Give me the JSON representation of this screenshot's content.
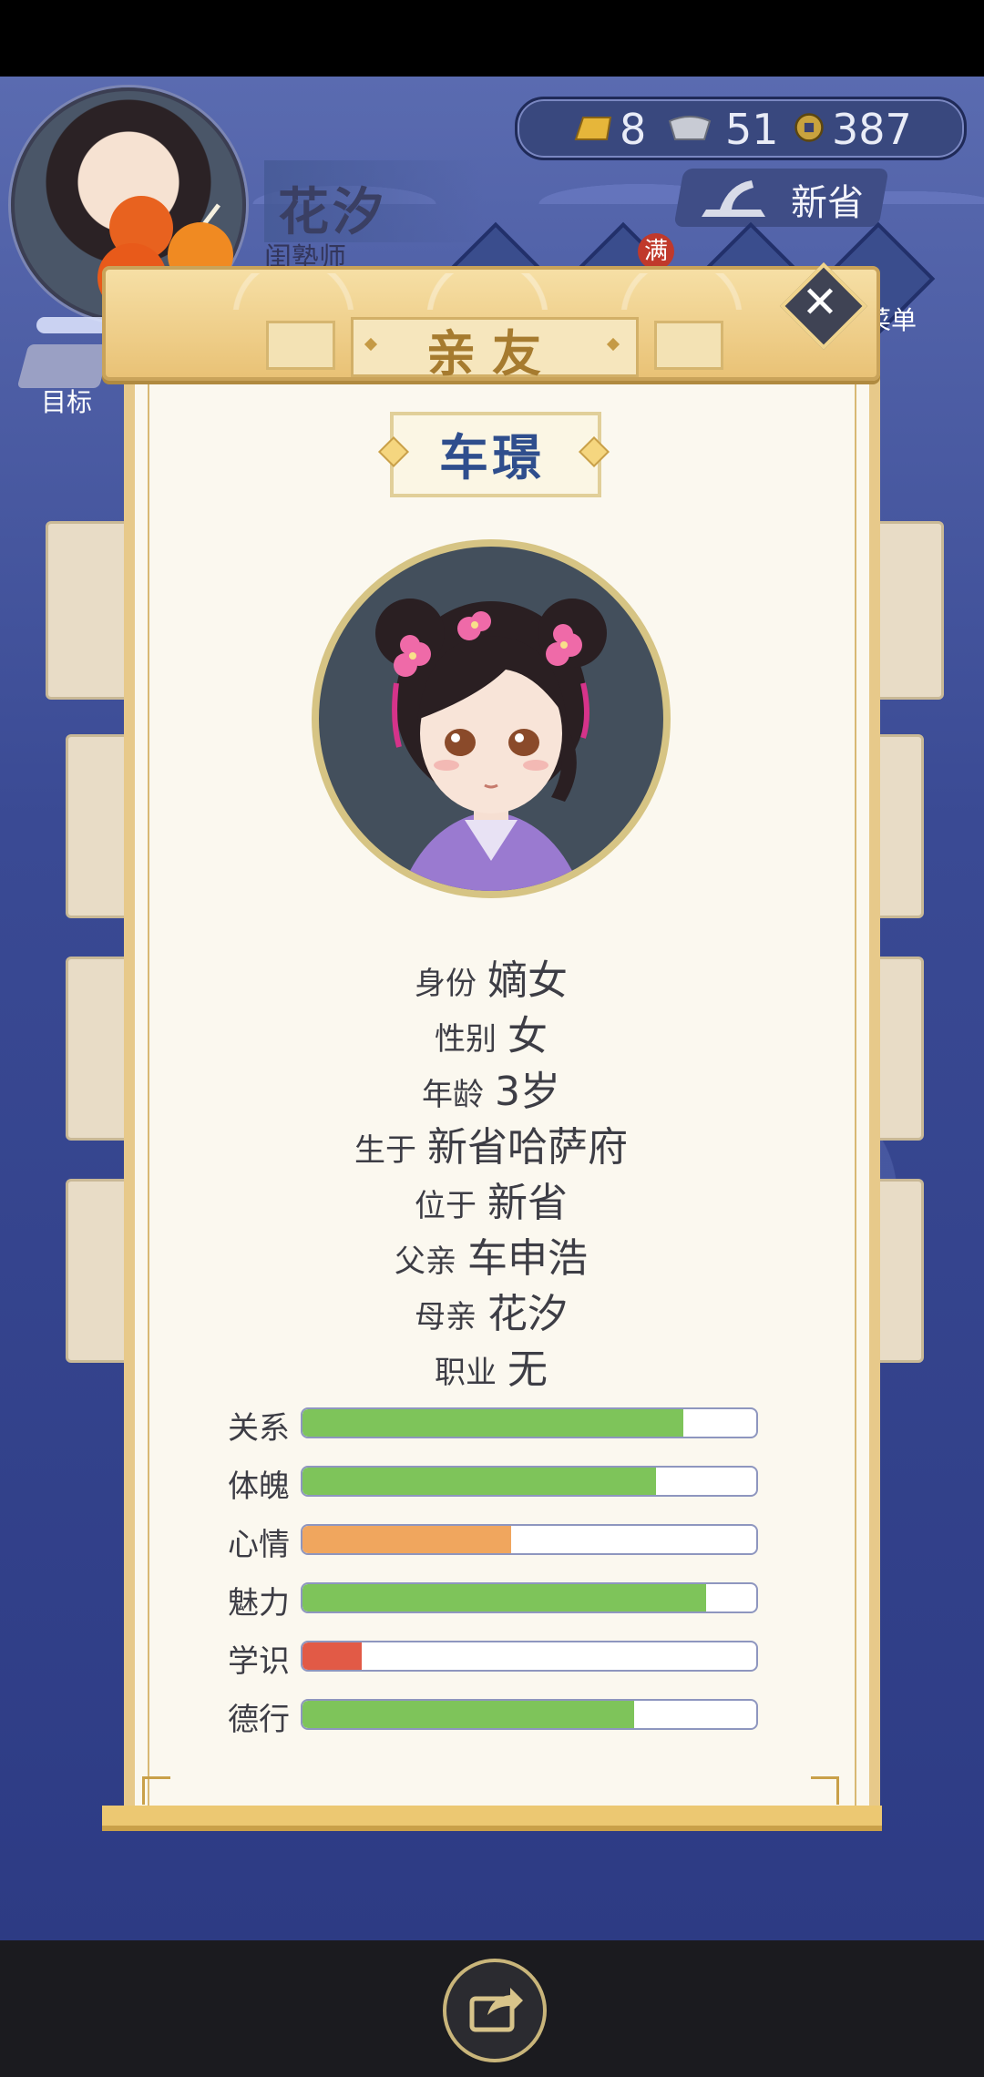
{
  "player": {
    "name": "花汐",
    "title": "闺塾师",
    "goal_label": "目标"
  },
  "currency": {
    "gold": "8",
    "silver": "51",
    "coins": "387"
  },
  "location": {
    "label": "新省"
  },
  "top_menu": {
    "menu_label": "菜单",
    "full_badge": "满"
  },
  "dialog": {
    "title": "亲友",
    "close_icon": "close-icon"
  },
  "child": {
    "name": "车璟",
    "info": [
      {
        "key": "身份",
        "value": "嫡女"
      },
      {
        "key": "性别",
        "value": "女"
      },
      {
        "key": "年龄",
        "value": "3岁"
      },
      {
        "key": "生于",
        "value": "新省哈萨府"
      },
      {
        "key": "位于",
        "value": "新省"
      },
      {
        "key": "父亲",
        "value": "车申浩"
      },
      {
        "key": "母亲",
        "value": "花汐"
      },
      {
        "key": "职业",
        "value": "无"
      }
    ],
    "stats": [
      {
        "label": "关系",
        "fraction": 0.84,
        "color": "#7ec45a"
      },
      {
        "label": "体魄",
        "fraction": 0.78,
        "color": "#7ec45a"
      },
      {
        "label": "心情",
        "fraction": 0.46,
        "color": "#f0a65e"
      },
      {
        "label": "魅力",
        "fraction": 0.89,
        "color": "#7ec45a"
      },
      {
        "label": "学识",
        "fraction": 0.13,
        "color": "#e25a46"
      },
      {
        "label": "德行",
        "fraction": 0.73,
        "color": "#7ec45a"
      }
    ]
  },
  "bottom": {
    "share_icon": "share-icon"
  }
}
